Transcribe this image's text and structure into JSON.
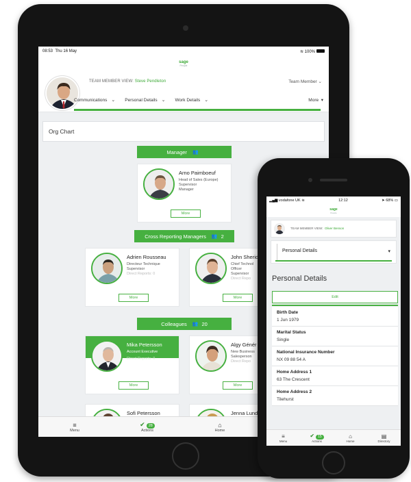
{
  "tablet": {
    "status": {
      "time": "08:53",
      "date": "Thu 16 May",
      "battery": "100%"
    },
    "logo": {
      "brand": "sage",
      "product": "People"
    },
    "header": {
      "team_member_view_label": "TEAM MEMBER VIEW:",
      "team_member_name": "Steve Pendleton",
      "role_dropdown": "Team Member",
      "nav": [
        "Communications",
        "Personal Details",
        "Work Details"
      ],
      "more_label": "More"
    },
    "org_chart_label": "Org Chart",
    "manager_bar": {
      "label": "Manager"
    },
    "manager": {
      "name": "Arno Paimboeuf",
      "lines": [
        "Head of Sales (Europe)",
        "Supervisor",
        "Manager"
      ],
      "more": "More"
    },
    "cross_bar": {
      "label": "Cross Reporting Managers",
      "count": "2"
    },
    "cross": [
      {
        "name": "Adrien Rousseau",
        "lines": [
          "Directeur Technique",
          "Supervisor",
          "Direct Reports: 0"
        ],
        "more": "More"
      },
      {
        "name": "John Sherid",
        "lines": [
          "Chief Technol",
          "Officer",
          "Supervisor",
          "Direct Repo"
        ],
        "more": "More"
      }
    ],
    "colleagues_bar": {
      "label": "Colleagues",
      "count": "20"
    },
    "colleagues": [
      {
        "name": "Mika Petersson",
        "lines": [
          "Account Executive",
          "Direct Reports: 0"
        ],
        "more": "More"
      },
      {
        "name": "Algy Génér",
        "lines": [
          "New Business",
          "Salesperson",
          "Direct Repo"
        ],
        "more": "More"
      },
      {
        "name": "Sofi Petersson"
      },
      {
        "name": "Jenna Lund"
      }
    ],
    "tabbar": {
      "menu": "Menu",
      "actions": "Actions",
      "actions_count": "28",
      "home": "Home"
    }
  },
  "phone": {
    "status": {
      "carrier": "vodafone UK",
      "time": "12:12",
      "battery": "68%"
    },
    "logo": {
      "brand": "sage",
      "product": "People"
    },
    "team_member_view_label": "TEAM MEMBER VIEW:",
    "team_member_name": "Oliver Benson",
    "dropdown": "Personal Details",
    "section_title": "Personal Details",
    "edit_label": "Edit",
    "fields": [
      {
        "label": "Birth Date",
        "value": "1 Jun 1979"
      },
      {
        "label": "Marital Status",
        "value": "Single"
      },
      {
        "label": "National Insurance Number",
        "value": "NX 09 88 54 A"
      },
      {
        "label": "Home Address 1",
        "value": "63 The Crescent"
      },
      {
        "label": "Home Address 2",
        "value": "Tilehurst"
      }
    ],
    "tabbar": {
      "menu": "Menu",
      "actions": "Actions",
      "actions_count": "15",
      "home": "Home",
      "directory": "Directory"
    }
  },
  "icons": {
    "people": "group-icon",
    "chevron": "chevron-down-icon",
    "check": "check-icon",
    "home": "home-icon",
    "menu": "hamburger-icon",
    "directory": "directory-icon"
  },
  "colors": {
    "accent": "#46b040",
    "background": "#eef0f2"
  }
}
